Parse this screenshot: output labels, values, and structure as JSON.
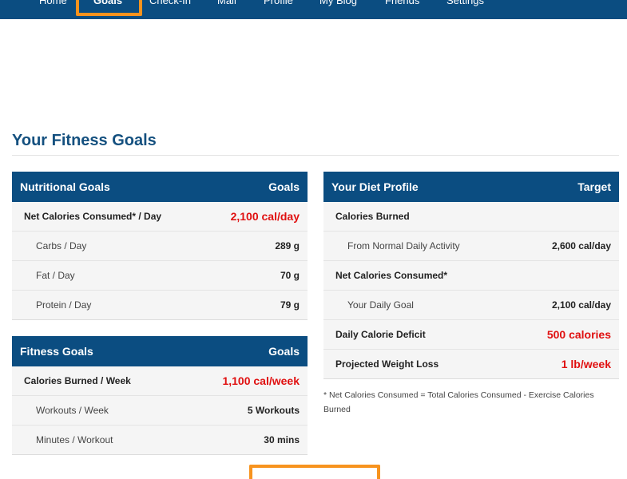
{
  "nav": {
    "items": [
      "Home",
      "Goals",
      "Check-In",
      "Mail",
      "Profile",
      "My Blog",
      "Friends",
      "Settings"
    ],
    "active": "Goals",
    "highlight_color": "#f7931e",
    "bar_color": "#0b4d81"
  },
  "page_title": "Your Fitness Goals",
  "nutritional": {
    "header_left": "Nutritional Goals",
    "header_right": "Goals",
    "rows": [
      {
        "label": "Net Calories Consumed* / Day",
        "value": "2,100 cal/day"
      },
      {
        "label": "Carbs / Day",
        "value": "289 g"
      },
      {
        "label": "Fat / Day",
        "value": "70 g"
      },
      {
        "label": "Protein / Day",
        "value": "79 g"
      }
    ]
  },
  "fitness": {
    "header_left": "Fitness Goals",
    "header_right": "Goals",
    "rows": [
      {
        "label": "Calories Burned / Week",
        "value": "1,100 cal/week"
      },
      {
        "label": "Workouts / Week",
        "value": "5 Workouts"
      },
      {
        "label": "Minutes / Workout",
        "value": "30 mins"
      }
    ]
  },
  "diet": {
    "header_left": "Your Diet Profile",
    "header_right": "Target",
    "rows": [
      {
        "label": "Calories Burned",
        "value": ""
      },
      {
        "label": "From Normal Daily Activity",
        "value": "2,600 cal/day"
      },
      {
        "label": "Net Calories Consumed*",
        "value": ""
      },
      {
        "label": "Your Daily Goal",
        "value": "2,100 cal/day"
      },
      {
        "label": "Daily Calorie Deficit",
        "value": "500 calories"
      },
      {
        "label": "Projected Weight Loss",
        "value": "1 lb/week"
      }
    ]
  },
  "footnote": "* Net Calories Consumed = Total Calories Consumed - Exercise Calories Burned",
  "colors": {
    "title": "#14507f",
    "emphasis_red": "#e01010"
  }
}
